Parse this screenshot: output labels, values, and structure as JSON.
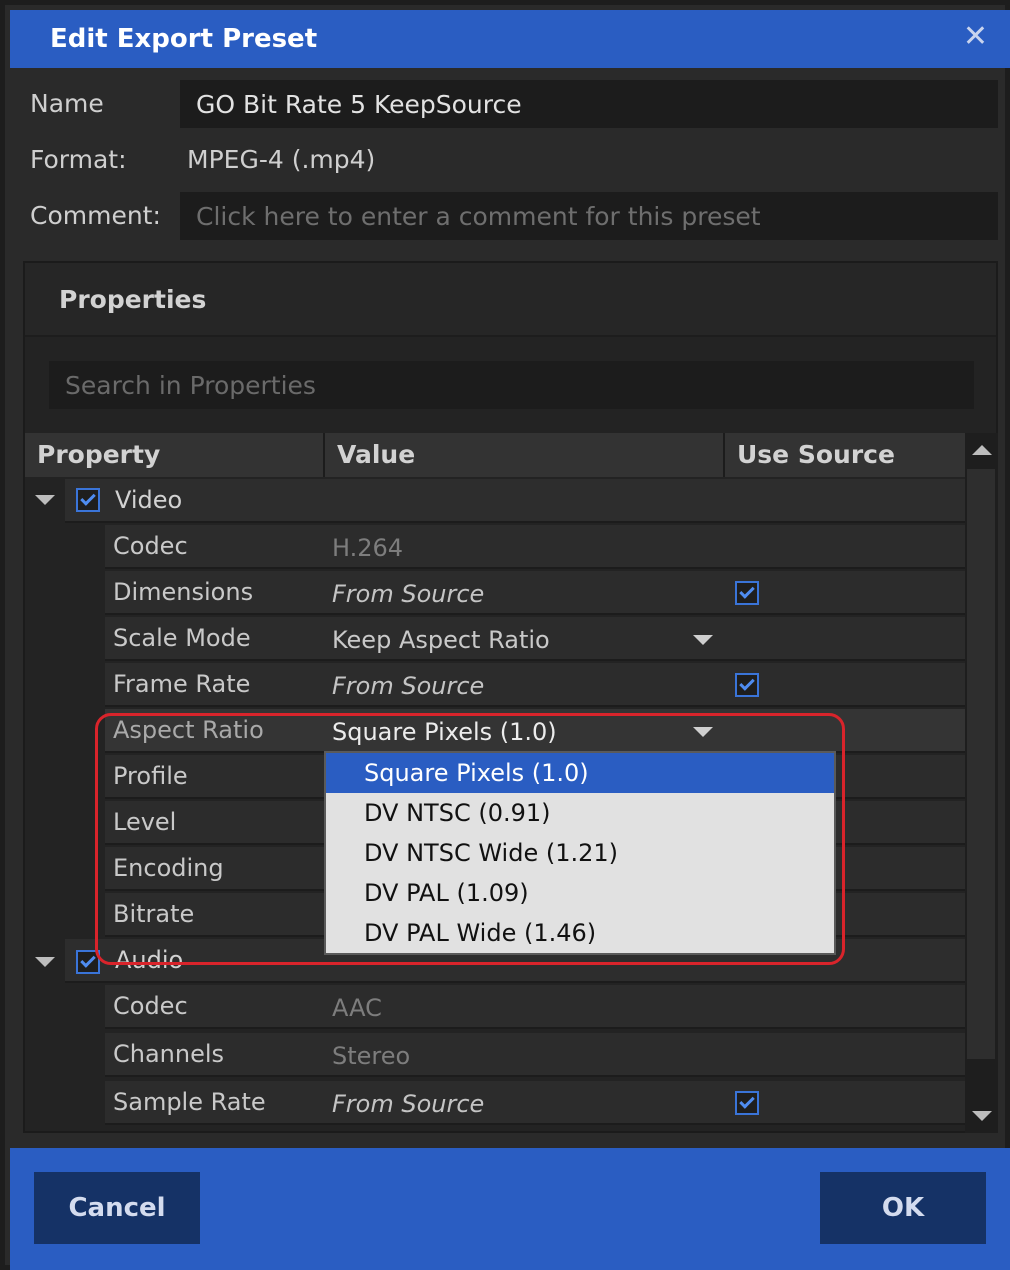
{
  "dialog": {
    "title": "Edit Export Preset",
    "close_glyph": "✕"
  },
  "form": {
    "name_label": "Name",
    "name_value": "GO Bit Rate 5 KeepSource",
    "format_label": "Format:",
    "format_value": "MPEG-4 (.mp4)",
    "comment_label": "Comment:",
    "comment_placeholder": "Click here to enter a comment for this preset"
  },
  "properties": {
    "title": "Properties",
    "search_placeholder": "Search in Properties",
    "columns": [
      "Property",
      "Value",
      "Use Source"
    ],
    "groups": [
      {
        "label": "Video",
        "checked": true,
        "rows": [
          {
            "property": "Codec",
            "value": "H.264"
          },
          {
            "property": "Dimensions",
            "value": "From Source",
            "use_source": true
          },
          {
            "property": "Scale Mode",
            "value": "Keep Aspect Ratio",
            "dropdown": true
          },
          {
            "property": "Frame Rate",
            "value": "From Source",
            "use_source": true
          },
          {
            "property": "Aspect Ratio",
            "value": "Square Pixels (1.0)",
            "dropdown": true
          },
          {
            "property": "Profile"
          },
          {
            "property": "Level"
          },
          {
            "property": "Encoding"
          },
          {
            "property": "Bitrate"
          }
        ]
      },
      {
        "label": "Audio",
        "checked": true,
        "rows": [
          {
            "property": "Codec",
            "value": "AAC"
          },
          {
            "property": "Channels",
            "value": "Stereo"
          },
          {
            "property": "Sample Rate",
            "value": "From Source",
            "use_source": true
          }
        ]
      }
    ],
    "aspect_ratio_options": [
      "Square Pixels (1.0)",
      "DV NTSC (0.91)",
      "DV NTSC Wide (1.21)",
      "DV PAL (1.09)",
      "DV PAL Wide (1.46)"
    ],
    "selected_option": "Square Pixels (1.0)"
  },
  "footer": {
    "cancel_label": "Cancel",
    "ok_label": "OK"
  },
  "colors": {
    "accent": "#2a5dc2",
    "button": "#153266",
    "highlight_box": "#d9242b",
    "checkbox": "#3a74d8"
  }
}
